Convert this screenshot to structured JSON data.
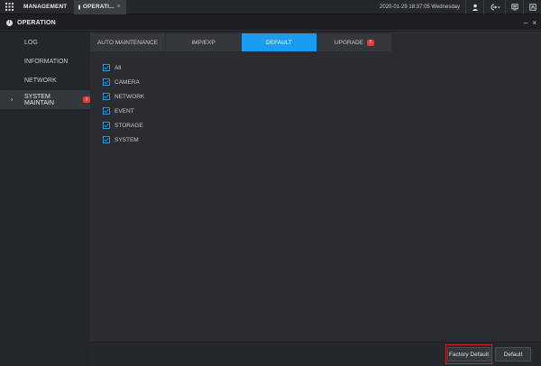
{
  "topbar": {
    "tabs": [
      {
        "label": "MANAGEMENT"
      },
      {
        "label": "OPERATI...",
        "close": "×"
      }
    ],
    "datetime": "2020-01-29 18:37:05 Wednesday"
  },
  "titlebar": {
    "title": "OPERATION",
    "minimize": "–",
    "close": "×"
  },
  "sidebar": {
    "items": [
      {
        "label": "LOG"
      },
      {
        "label": "INFORMATION"
      },
      {
        "label": "NETWORK"
      },
      {
        "label": "SYSTEM MAINTAIN",
        "badge": "!",
        "active": true,
        "arrow": "›"
      }
    ]
  },
  "tabs": [
    {
      "label": "AUTO MAINTENANCE"
    },
    {
      "label": "IMP/EXP"
    },
    {
      "label": "DEFAULT",
      "active": true
    },
    {
      "label": "UPGRADE",
      "badge": "!"
    }
  ],
  "checks": [
    {
      "label": "All",
      "checked": true
    },
    {
      "label": "CAMERA",
      "checked": true
    },
    {
      "label": "NETWORK",
      "checked": true
    },
    {
      "label": "EVENT",
      "checked": true
    },
    {
      "label": "STORAGE",
      "checked": true
    },
    {
      "label": "SYSTEM",
      "checked": true
    }
  ],
  "buttons": {
    "factory_default": "Factory Default",
    "default": "Default"
  },
  "colors": {
    "accent": "#1a9cf0",
    "badge": "#e23c3c",
    "highlight": "#d6262b"
  },
  "icons": {
    "grid": "grid-icon",
    "user": "user-icon",
    "logout": "logout-icon",
    "monitor": "monitor-icon",
    "device": "device-icon"
  }
}
